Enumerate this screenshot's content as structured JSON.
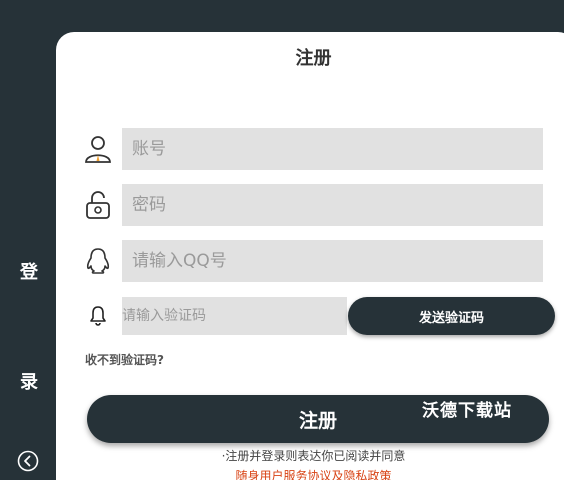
{
  "sidebar": {
    "char_top": "登",
    "char_bottom": "录",
    "back_icon": "chevron-left-circle-icon"
  },
  "register": {
    "title": "注册",
    "account_placeholder": "账号",
    "password_placeholder": "密码",
    "qq_placeholder": "请输入QQ号",
    "code_placeholder": "请输入验证码",
    "send_code_label": "发送验证码",
    "no_code_text": "收不到验证码?",
    "submit_label": "注册",
    "agree_text": "·注册并登录则表达你已阅读并同意",
    "policy_text": "随身用户服务协议及隐私政策",
    "watermark": "沃德下载站"
  },
  "colors": {
    "dark": "#263238",
    "field_bg": "#e1e1e1",
    "policy": "#d84315"
  }
}
